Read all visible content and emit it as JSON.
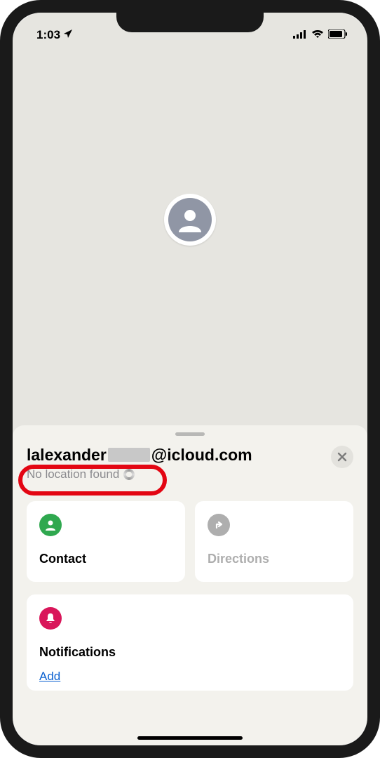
{
  "status": {
    "time": "1:03"
  },
  "sheet": {
    "title_prefix": "lalexander",
    "title_suffix": "@icloud.com",
    "subtitle": "No location found",
    "close_label": "Close"
  },
  "tiles": {
    "contact": {
      "label": "Contact"
    },
    "directions": {
      "label": "Directions"
    }
  },
  "notifications": {
    "title": "Notifications",
    "add_label": "Add"
  }
}
